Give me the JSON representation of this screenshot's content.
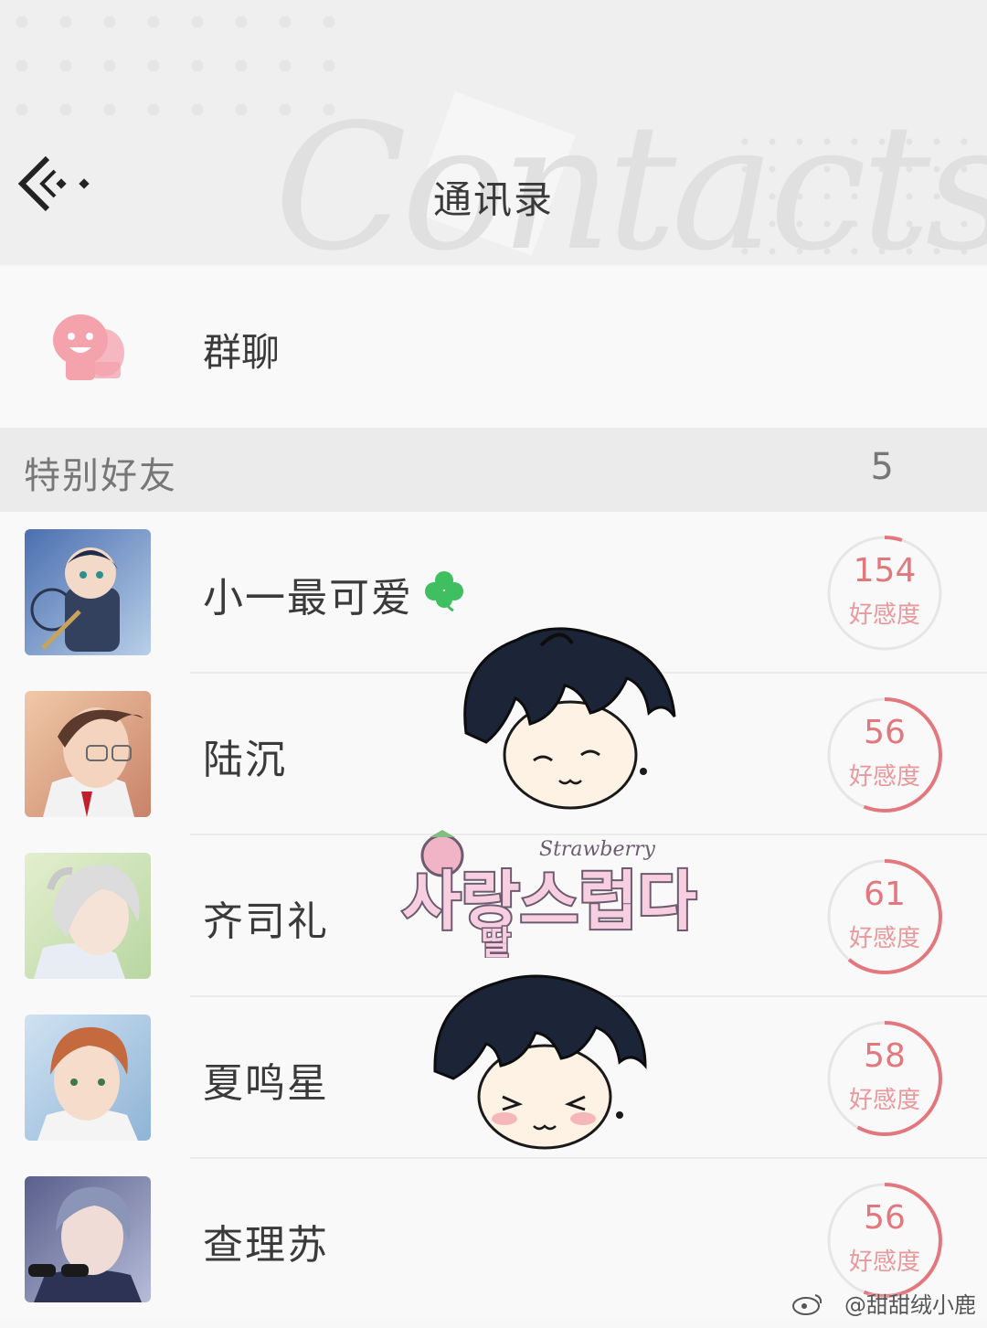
{
  "header": {
    "title": "通讯录",
    "watermark": "Contacts",
    "back_icon": "back-arrow-icon"
  },
  "group_chat": {
    "label": "群聊",
    "icon": "group-chat-icon",
    "icon_color": "#f4a2ac"
  },
  "section": {
    "title": "特别好友",
    "count": "5"
  },
  "contacts": [
    {
      "name": "小一最可爱",
      "favor": "154",
      "favor_label": "好感度",
      "favor_fraction": 0.05,
      "badge": "clover-icon"
    },
    {
      "name": "陆沉",
      "favor": "56",
      "favor_label": "好感度",
      "favor_fraction": 0.56
    },
    {
      "name": "齐司礼",
      "favor": "61",
      "favor_label": "好感度",
      "favor_fraction": 0.61
    },
    {
      "name": "夏鸣星",
      "favor": "58",
      "favor_label": "好感度",
      "favor_fraction": 0.58
    },
    {
      "name": "查理苏",
      "favor": "56",
      "favor_label": "好感度",
      "favor_fraction": 0.56
    }
  ],
  "colors": {
    "accent": "#e2787e",
    "ring_track": "#e6e6e6"
  },
  "stickers": {
    "strawberry_text": "Strawberry",
    "korean_text": "사랑스럽다",
    "korean_sub": "딸"
  },
  "credit": "@甜甜绒小鹿"
}
